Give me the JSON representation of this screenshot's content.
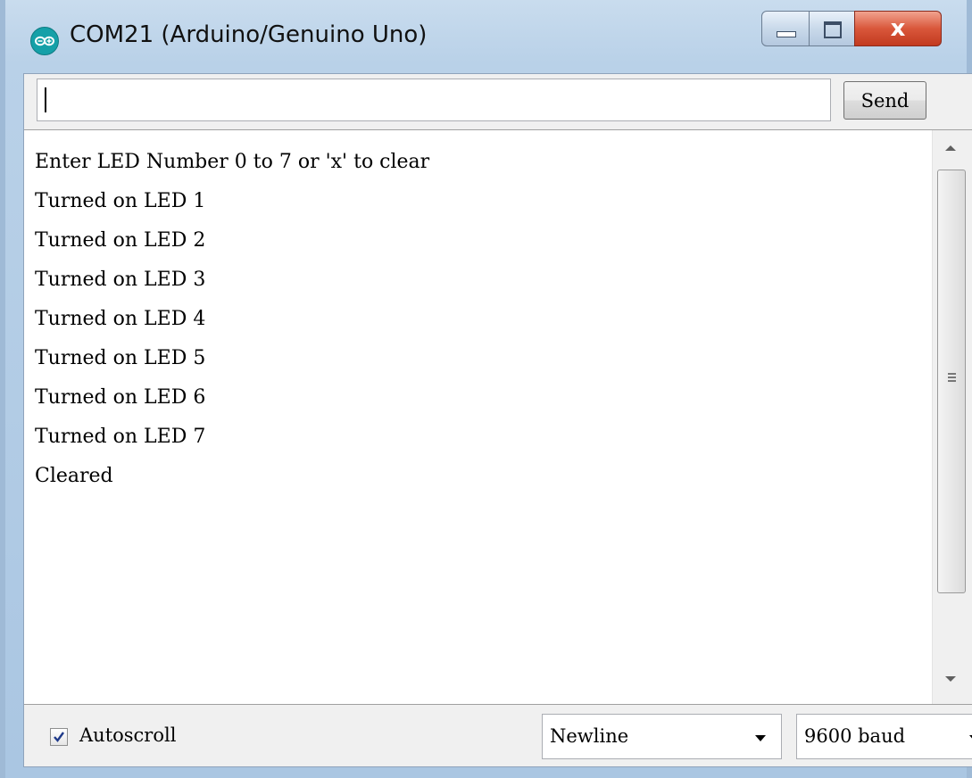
{
  "window": {
    "title": "COM21 (Arduino/Genuino Uno)",
    "icon": "arduino-logo-icon",
    "controls": [
      "minimize-icon",
      "maximize-icon",
      "close-icon"
    ],
    "close_label": "x"
  },
  "input_bar": {
    "value": "",
    "send_label": "Send"
  },
  "serial_output": [
    "Enter LED Number 0 to 7 or 'x' to clear",
    "Turned on LED 1",
    "Turned on LED 2",
    "Turned on LED 3",
    "Turned on LED 4",
    "Turned on LED 5",
    "Turned on LED 6",
    "Turned on LED 7",
    "Cleared"
  ],
  "footer": {
    "autoscroll_label": "Autoscroll",
    "autoscroll_checked": true,
    "line_ending": "Newline",
    "baud_rate": "9600 baud"
  },
  "colors": {
    "title_bar": "#b9d1e8",
    "close_button": "#d9573b",
    "arduino_teal": "#15a0a8"
  }
}
